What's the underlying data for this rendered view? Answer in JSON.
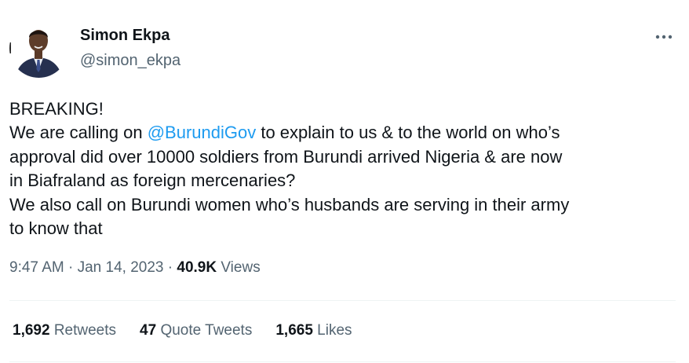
{
  "author": {
    "display_name": "Simon Ekpa",
    "handle": "@simon_ekpa",
    "avatar_icon": "profile-photo"
  },
  "more_icon": "more-horizontal-icon",
  "tweet": {
    "line1": "BREAKING!",
    "line2_before": "We are calling on ",
    "line2_mention": "@BurundiGov",
    "line2_after": " to explain to us & to the world on who’s",
    "line3": "approval did over 10000 soldiers from Burundi arrived Nigeria & are now",
    "line4": "in Biafraland as foreign mercenaries?",
    "line5": "We also call on Burundi women who’s husbands are serving in their army",
    "line6": "to know that"
  },
  "meta": {
    "time": "9:47 AM",
    "sep1": " · ",
    "date": "Jan 14, 2023",
    "sep2": " · ",
    "views_count": "40.9K",
    "views_label": " Views"
  },
  "stats": {
    "retweets_count": "1,692",
    "retweets_label": " Retweets",
    "quote_count": "47",
    "quote_label": " Quote Tweets",
    "likes_count": "1,665",
    "likes_label": " Likes"
  },
  "colors": {
    "accent": "#1d9bf0",
    "text_primary": "#0f1419",
    "text_secondary": "#536471",
    "divider": "#eff3f4"
  }
}
